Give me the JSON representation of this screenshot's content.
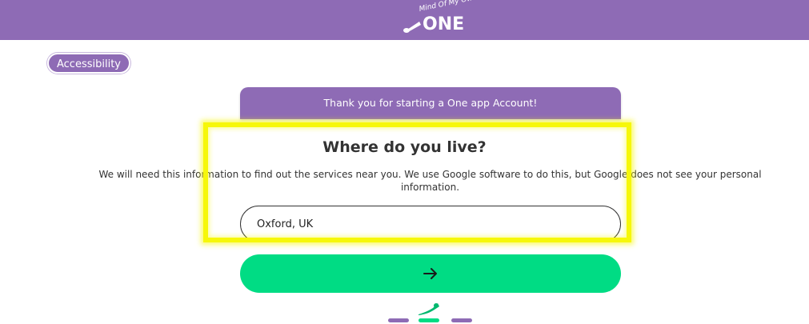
{
  "header": {
    "logo_sub": "Mind Of My Own",
    "logo_main": "ONE"
  },
  "accessibility": {
    "label": "Accessibility"
  },
  "banner": {
    "text": "Thank you for starting a One app Account!"
  },
  "question": {
    "title": "Where do you live?",
    "description": "We will need this information to find out the services near you. We use Google software to do this, but Google does not see your personal information."
  },
  "location_input": {
    "value": "Oxford, UK"
  },
  "next_button": {
    "icon": "arrow-right-icon"
  },
  "progress": {
    "total_steps": 3,
    "current_step": 2
  },
  "colors": {
    "brand_purple": "#8e6bb5",
    "accent_green": "#00dc84",
    "highlight_yellow": "#f6f70a"
  }
}
